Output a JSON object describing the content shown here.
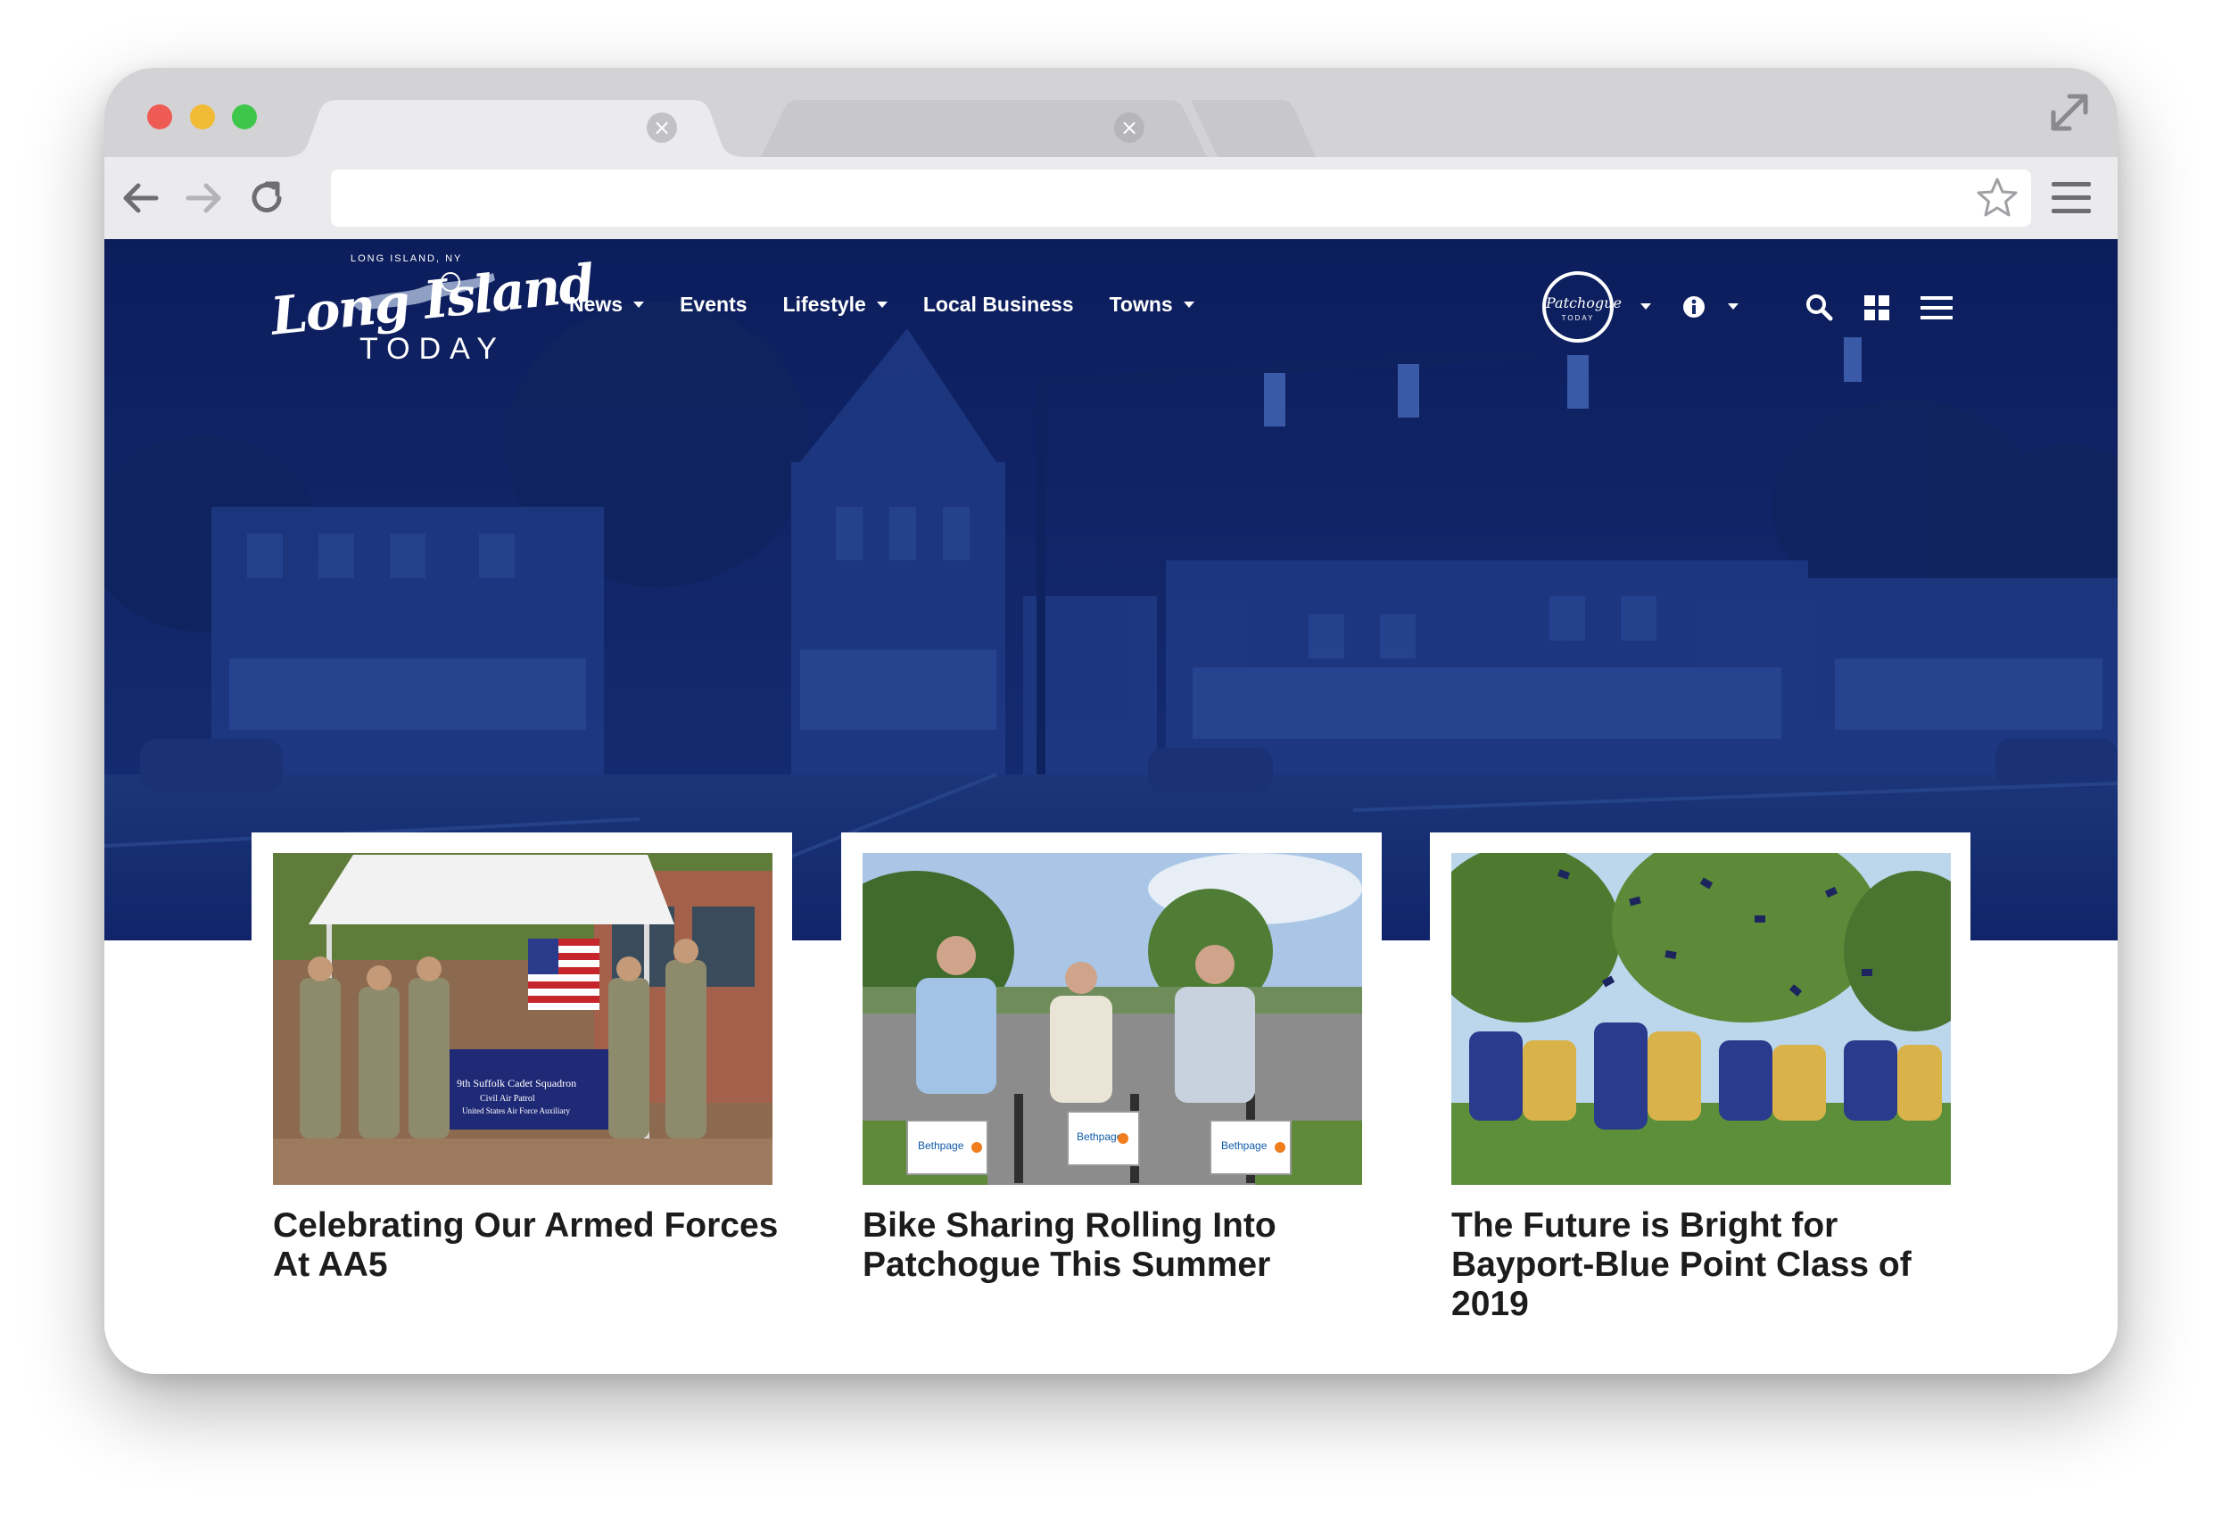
{
  "browser": {
    "url": "",
    "tabs": [
      {
        "label": ""
      },
      {
        "label": ""
      }
    ]
  },
  "site": {
    "logo": {
      "tagline": "LONG ISLAND, NY",
      "script": "Long Island",
      "today": "TODAY"
    },
    "nav": [
      {
        "label": "News",
        "dropdown": true
      },
      {
        "label": "Events",
        "dropdown": false
      },
      {
        "label": "Lifestyle",
        "dropdown": true
      },
      {
        "label": "Local Business",
        "dropdown": false
      },
      {
        "label": "Towns",
        "dropdown": true
      }
    ],
    "town_badge": {
      "script": "Patchogue",
      "sub": "TODAY"
    },
    "icons": [
      "info-icon",
      "search-icon",
      "grid-icon",
      "hamburger-icon"
    ],
    "colors": {
      "hero": "#13296b",
      "text": "#1c1c1c"
    }
  },
  "cards": [
    {
      "title": "Celebrating Our Armed Forces At AA5",
      "image": "cadets-tent-photo",
      "image_text": [
        "9th Suffolk Cadet Squadron",
        "Civil Air Patrol",
        "United States Air Force Auxiliary"
      ]
    },
    {
      "title": "Bike Sharing Rolling Into Patchogue This Summer",
      "image": "bike-sharing-photo",
      "image_text": [
        "Bethpage"
      ]
    },
    {
      "title": "The Future is Bright for Bayport-Blue Point Class of 2019",
      "image": "graduation-caps-photo",
      "image_text": []
    }
  ]
}
